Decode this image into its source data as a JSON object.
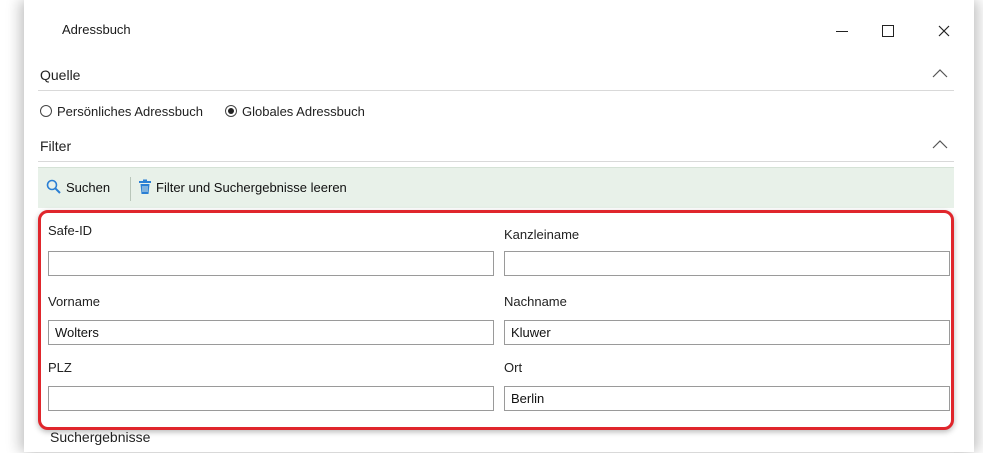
{
  "window": {
    "title": "Adressbuch",
    "controls": {
      "minimize": "minimize-icon",
      "maximize": "maximize-icon",
      "close": "close-icon"
    }
  },
  "sections": {
    "quelle": "Quelle",
    "filter": "Filter",
    "results": "Suchergebnisse"
  },
  "source": {
    "options": [
      {
        "label": "Persönliches Adressbuch",
        "checked": false
      },
      {
        "label": "Globales Adressbuch",
        "checked": true
      }
    ]
  },
  "toolbar": {
    "search_label": "Suchen",
    "clear_label": "Filter und Suchergebnisse leeren",
    "accent": "#e8f1e9"
  },
  "filter": {
    "highlight_color": "#e0262c",
    "fields": {
      "safe_id": {
        "label": "Safe-ID",
        "value": ""
      },
      "kanzleiname": {
        "label": "Kanzleiname",
        "value": ""
      },
      "vorname": {
        "label": "Vorname",
        "value": "Wolters"
      },
      "nachname": {
        "label": "Nachname",
        "value": "Kluwer"
      },
      "plz": {
        "label": "PLZ",
        "value": ""
      },
      "ort": {
        "label": "Ort",
        "value": "Berlin"
      }
    }
  }
}
